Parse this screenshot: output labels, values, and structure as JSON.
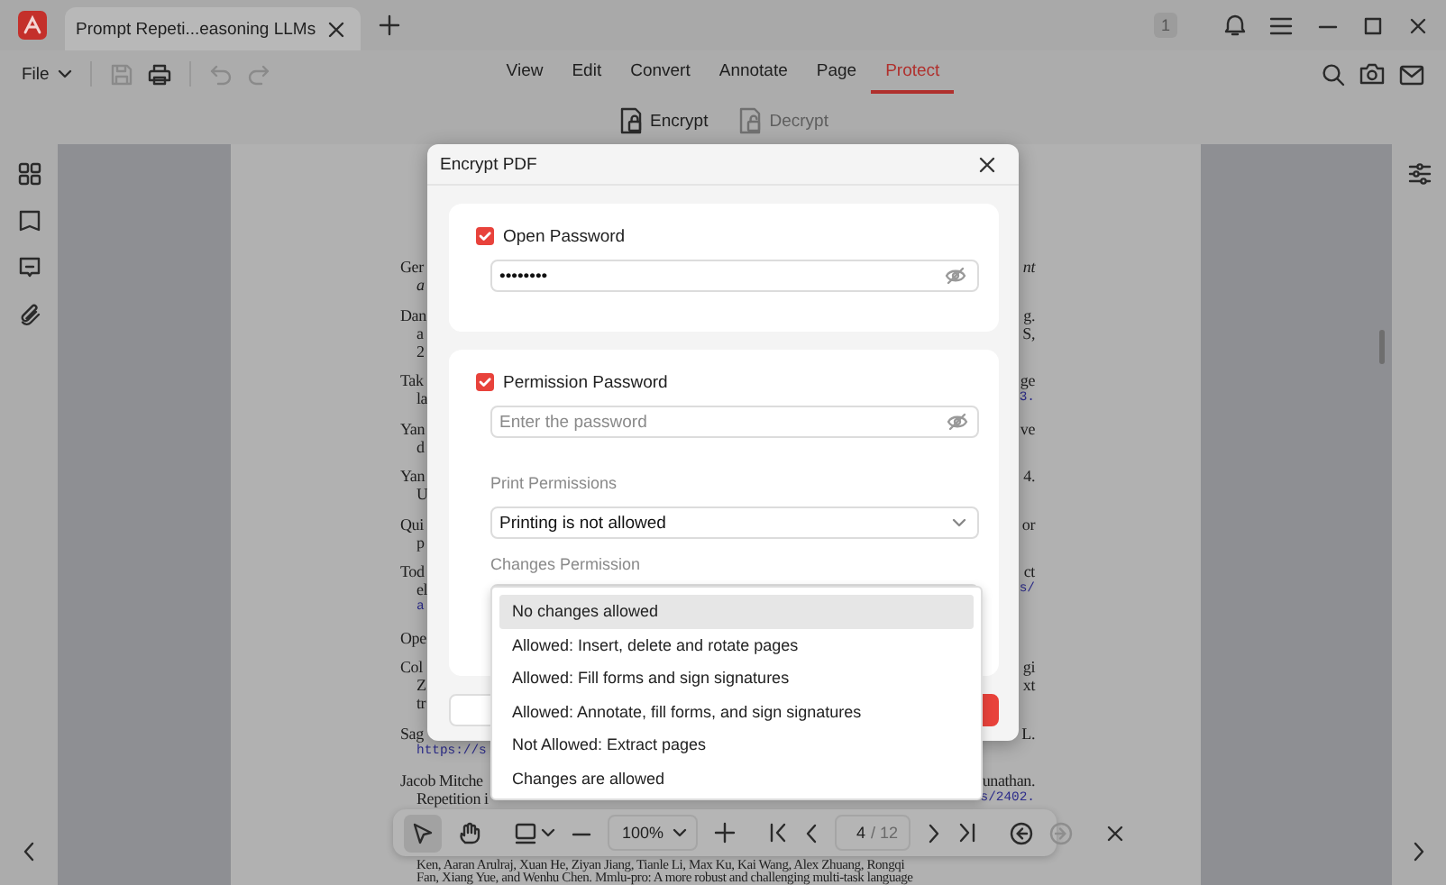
{
  "titlebar": {
    "tab_title": "Prompt Repeti...easoning LLMs",
    "badge": "1"
  },
  "menubar": {
    "file": "File",
    "tools": [
      {
        "kind": "save",
        "disabled": true
      },
      {
        "kind": "print",
        "disabled": false
      },
      {
        "kind": "undo",
        "disabled": true
      },
      {
        "kind": "redo",
        "disabled": true
      }
    ],
    "tabs": [
      {
        "label": "View",
        "selected": false
      },
      {
        "label": "Edit",
        "selected": false
      },
      {
        "label": "Convert",
        "selected": false
      },
      {
        "label": "Annotate",
        "selected": false
      },
      {
        "label": "Page",
        "selected": false
      },
      {
        "label": "Protect",
        "selected": true
      }
    ]
  },
  "subtools": [
    {
      "kind": "encrypt",
      "label": "Encrypt",
      "disabled": false
    },
    {
      "kind": "decrypt",
      "label": "Decrypt",
      "disabled": true
    }
  ],
  "document": {
    "entries": [
      {
        "lines": [
          {
            "left": {
              "text": "Ger",
              "kind": "plain"
            },
            "right": {
              "text": "nt",
              "kind": "italic"
            }
          },
          {
            "left": {
              "text": "a",
              "kind": "italic"
            }
          }
        ]
      },
      {
        "lines": [
          {
            "left": {
              "text": "Dan",
              "kind": "plain"
            },
            "right": {
              "text": "g.",
              "kind": "plain"
            }
          },
          {
            "left": {
              "text": "a",
              "kind": "plain"
            },
            "right": {
              "text": "S,",
              "kind": "plain"
            }
          },
          {
            "left": {
              "text": "2",
              "kind": "plain"
            }
          }
        ]
      },
      {
        "lines": [
          {
            "left": {
              "text": "Tak",
              "kind": "plain"
            },
            "right": {
              "text": "ge",
              "kind": "plain"
            }
          },
          {
            "left": {
              "text": "la",
              "kind": "plain"
            },
            "right": {
              "text": "3.",
              "kind": "link"
            }
          }
        ]
      },
      {
        "lines": [
          {
            "left": {
              "text": "Yan",
              "kind": "plain"
            },
            "right": {
              "text": "ve",
              "kind": "plain"
            }
          },
          {
            "left": {
              "text": "d",
              "kind": "plain"
            }
          }
        ]
      },
      {
        "lines": [
          {
            "left": {
              "text": "Yan",
              "kind": "plain"
            },
            "right": {
              "text": "4.",
              "kind": "plain"
            }
          },
          {
            "left": {
              "text": "U",
              "kind": "plain"
            }
          }
        ]
      },
      {
        "lines": [
          {
            "left": {
              "text": "Qui",
              "kind": "plain"
            },
            "right": {
              "text": "or",
              "kind": "plain"
            }
          },
          {
            "left": {
              "text": "p",
              "kind": "plain"
            }
          }
        ]
      },
      {
        "lines": [
          {
            "left": {
              "text": "Tod",
              "kind": "plain"
            },
            "right": {
              "text": "ct",
              "kind": "plain"
            }
          },
          {
            "left": {
              "text": "el",
              "kind": "plain"
            },
            "right": {
              "text": "s/",
              "kind": "link"
            }
          },
          {
            "left": {
              "text": "a",
              "kind": "link"
            }
          }
        ]
      },
      {
        "lines": [
          {
            "left": {
              "text": "Ope",
              "kind": "plain"
            }
          }
        ]
      },
      {
        "lines": [
          {
            "left": {
              "text": "Col",
              "kind": "plain"
            },
            "right": {
              "text": "gi",
              "kind": "plain"
            }
          },
          {
            "left": {
              "text": "Z",
              "kind": "plain"
            },
            "right": {
              "text": "xt",
              "kind": "plain"
            }
          },
          {
            "left": {
              "text": "tr",
              "kind": "plain"
            }
          }
        ]
      },
      {
        "lines": [
          {
            "left": {
              "text": "Sag",
              "kind": "plain"
            },
            "right": {
              "text": "L.",
              "kind": "plain"
            }
          },
          {
            "left": {
              "text": "https://s",
              "kind": "link"
            }
          }
        ]
      },
      {
        "lines": [
          {
            "left": {
              "text": "Jacob Mitche",
              "kind": "plain"
            },
            "right": {
              "text": "unathan.",
              "kind": "plain"
            }
          },
          {
            "left": {
              "text": "Repetition i",
              "kind": "plain"
            },
            "right": {
              "text": "s/2402.",
              "kind": "link"
            }
          }
        ]
      }
    ],
    "tail": [
      "Ken, Aaran Arulraj, Xuan He, Ziyan Jiang, Tianle Li, Max Ku, Kai Wang, Alex Zhuang, Rongqi",
      "Fan, Xiang Yue, and Wenhu Chen. Mmlu-pro: A more robust and challenging multi-task language"
    ]
  },
  "dialog": {
    "title": "Encrypt PDF",
    "open_password": {
      "label": "Open Password",
      "checked": true,
      "value": "••••••••"
    },
    "permission_password": {
      "label": "Permission Password",
      "checked": true,
      "placeholder": "Enter the password"
    },
    "print_permissions": {
      "label": "Print Permissions",
      "value": "Printing is not allowed"
    },
    "changes_permission": {
      "label": "Changes Permission"
    }
  },
  "dropdown": {
    "options": [
      {
        "label": "No changes allowed",
        "selected": true
      },
      {
        "label": "Allowed: Insert, delete and rotate pages",
        "selected": false
      },
      {
        "label": "Allowed: Fill forms and sign signatures",
        "selected": false
      },
      {
        "label": "Allowed: Annotate, fill forms, and sign signatures",
        "selected": false
      },
      {
        "label": "Not Allowed: Extract pages",
        "selected": false
      },
      {
        "label": "Changes are allowed",
        "selected": false
      }
    ]
  },
  "navbar": {
    "zoom": "100%",
    "page": "4",
    "page_total": "/ 12",
    "forward_disabled": true
  }
}
